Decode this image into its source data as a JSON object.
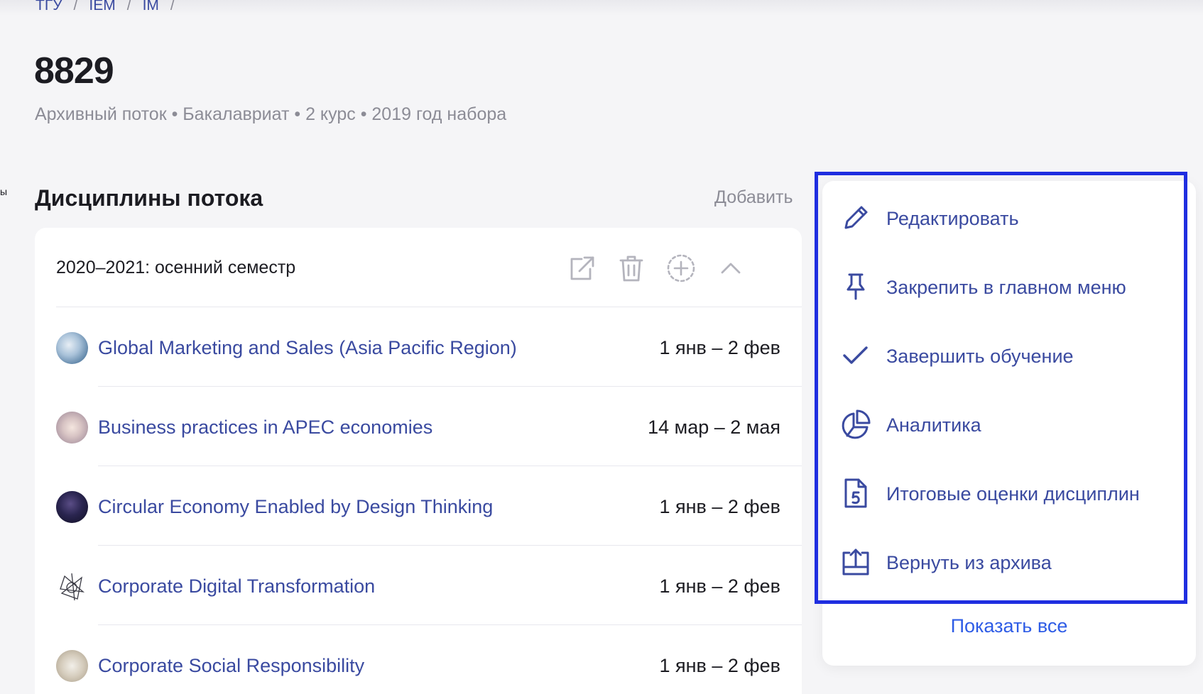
{
  "breadcrumb": [
    {
      "label": "ТГУ"
    },
    {
      "label": "IEM"
    },
    {
      "label": "IM"
    }
  ],
  "breadcrumb_separator": "/",
  "page": {
    "title": "8829",
    "subtitle": "Архивный поток • Бакалавриат • 2 курс • 2019 год набора"
  },
  "edge_mark": "ы",
  "disciplines": {
    "section_title": "Дисциплины потока",
    "add_label": "Добавить",
    "semester_title": "2020–2021: осенний семестр",
    "items": [
      {
        "name": "Global Marketing and Sales (Asia Pacific Region)",
        "dates": "1 янв – 2 фев"
      },
      {
        "name": "Business practices in APEC economies",
        "dates": "14 мар – 2 мая"
      },
      {
        "name": "Circular Economy Enabled by Design Thinking",
        "dates": "1 янв – 2 фев"
      },
      {
        "name": "Corporate Digital Transformation",
        "dates": "1 янв – 2 фев"
      },
      {
        "name": "Corporate Social Responsibility",
        "dates": "1 янв – 2 фев"
      }
    ]
  },
  "menu": {
    "items": [
      {
        "label": "Редактировать",
        "icon": "pencil-icon"
      },
      {
        "label": "Закрепить в главном меню",
        "icon": "pin-icon"
      },
      {
        "label": "Завершить обучение",
        "icon": "check-icon"
      },
      {
        "label": "Аналитика",
        "icon": "pie-chart-icon"
      },
      {
        "label": "Итоговые оценки дисциплин",
        "icon": "grade-document-icon"
      },
      {
        "label": "Вернуть из архива",
        "icon": "unarchive-icon"
      }
    ],
    "show_all_label": "Показать все"
  },
  "colors": {
    "accent": "#3a4aa0",
    "link": "#2e5ce6",
    "highlight": "#1f2ee0",
    "muted": "#8c8c96"
  }
}
